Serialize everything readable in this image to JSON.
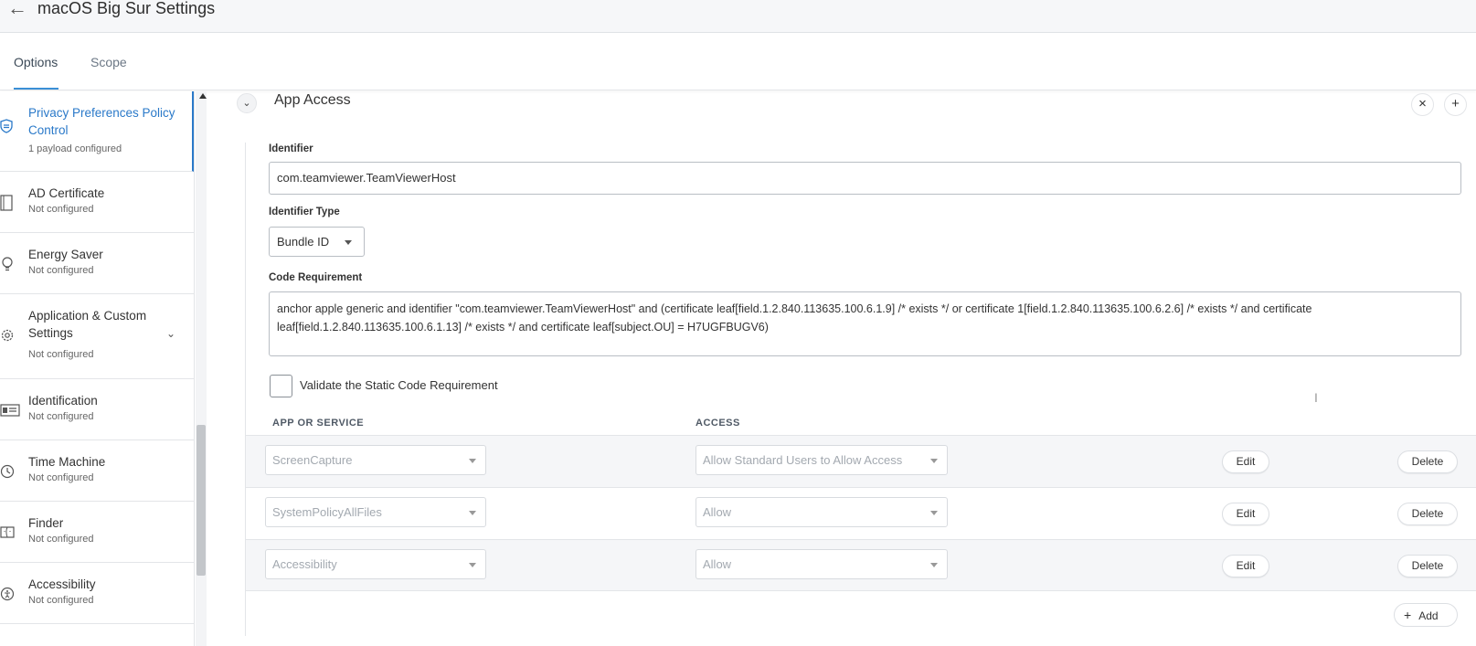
{
  "header": {
    "title": "macOS Big Sur Settings",
    "back_icon": "arrow-left-icon"
  },
  "tabs": [
    {
      "label": "Options",
      "active": true
    },
    {
      "label": "Scope",
      "active": false
    }
  ],
  "sidebar": {
    "items": [
      {
        "title": "Privacy Preferences Policy Control",
        "subtitle": "1 payload configured",
        "icon": "shield-icon",
        "active": true
      },
      {
        "title": "AD Certificate",
        "subtitle": "Not configured",
        "icon": "certificate-icon"
      },
      {
        "title": "Energy Saver",
        "subtitle": "Not configured",
        "icon": "lightbulb-icon"
      },
      {
        "title": "Application & Custom Settings",
        "subtitle": "Not configured",
        "icon": "gear-icon"
      },
      {
        "title": "Identification",
        "subtitle": "Not configured",
        "icon": "id-card-icon"
      },
      {
        "title": "Time Machine",
        "subtitle": "Not configured",
        "icon": "clock-icon"
      },
      {
        "title": "Finder",
        "subtitle": "Not configured",
        "icon": "finder-icon"
      },
      {
        "title": "Accessibility",
        "subtitle": "Not configured",
        "icon": "accessibility-icon"
      }
    ]
  },
  "section": {
    "title": "App Access",
    "identifier": {
      "label": "Identifier",
      "value": "com.teamviewer.TeamViewerHost"
    },
    "identifier_type": {
      "label": "Identifier Type",
      "value": "Bundle ID"
    },
    "code_requirement": {
      "label": "Code Requirement",
      "value": "anchor apple generic and identifier \"com.teamviewer.TeamViewerHost\" and (certificate leaf[field.1.2.840.113635.100.6.1.9] /* exists */ or certificate 1[field.1.2.840.113635.100.6.2.6] /* exists */ and certificate leaf[field.1.2.840.113635.100.6.1.13] /* exists */ and certificate leaf[subject.OU] = H7UGFBUGV6)"
    },
    "validate_label": "Validate the Static Code Requirement",
    "validate_checked": false,
    "table": {
      "col_app": "APP OR SERVICE",
      "col_access": "ACCESS",
      "rows": [
        {
          "app": "ScreenCapture",
          "access": "Allow Standard Users to Allow Access",
          "edit": "Edit",
          "delete": "Delete"
        },
        {
          "app": "SystemPolicyAllFiles",
          "access": "Allow",
          "edit": "Edit",
          "delete": "Delete"
        },
        {
          "app": "Accessibility",
          "access": "Allow",
          "edit": "Edit",
          "delete": "Delete"
        }
      ]
    },
    "add_label": "Add"
  },
  "colors": {
    "accent": "#2a79c9",
    "border": "#e3e5e8"
  }
}
